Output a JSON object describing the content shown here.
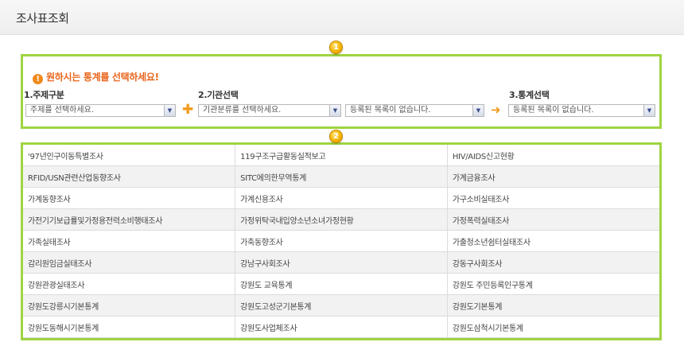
{
  "page": {
    "title": "조사표조회"
  },
  "badges": {
    "step1": "1",
    "step2": "2"
  },
  "selector": {
    "notice_icon": "!",
    "notice": "원하시는 통계를 선택하세요!",
    "steps": {
      "topic": "1.주제구분",
      "agency": "2.기관선택",
      "stat": "3.통계선택"
    },
    "dropdowns": {
      "topic": "주제를 선택하세요.",
      "agency_category": "기관분류를 선택하세요.",
      "agency_list": "등록된 목록이 없습니다.",
      "stat_list": "등록된 목록이 없습니다."
    },
    "plus_symbol": "✚",
    "arrow_symbol": "➜"
  },
  "colors": {
    "panel_border": "#9fd441",
    "notice_text": "#e8641a",
    "badge": "#f6b500",
    "connector": "#f29b1d"
  },
  "icons": {
    "dropdown_arrow": "▼"
  },
  "survey_list": [
    [
      "'97년인구이동특별조사",
      "119구조구급활동실적보고",
      "HIV/AIDS신고현황"
    ],
    [
      "RFID/USN관련산업동향조사",
      "SITC에의한무역통계",
      "가계금융조사"
    ],
    [
      "가계동향조사",
      "가계신용조사",
      "가구소비실태조사"
    ],
    [
      "가전기기보급률및가정용전력소비행태조사",
      "가정위탁국내입양소년소녀가정현황",
      "가정폭력실태조사"
    ],
    [
      "가족실태조사",
      "가축동향조사",
      "가출청소년쉼터실태조사"
    ],
    [
      "감리원임금실태조사",
      "강남구사회조사",
      "강동구사회조사"
    ],
    [
      "강원관광실태조사",
      "강원도 교육통계",
      "강원도 주민등록인구통계"
    ],
    [
      "강원도강릉시기본통계",
      "강원도고성군기본통계",
      "강원도기본통계"
    ],
    [
      "강원도동해시기본통계",
      "강원도사업체조사",
      "강원도삼척시기본통계"
    ]
  ]
}
